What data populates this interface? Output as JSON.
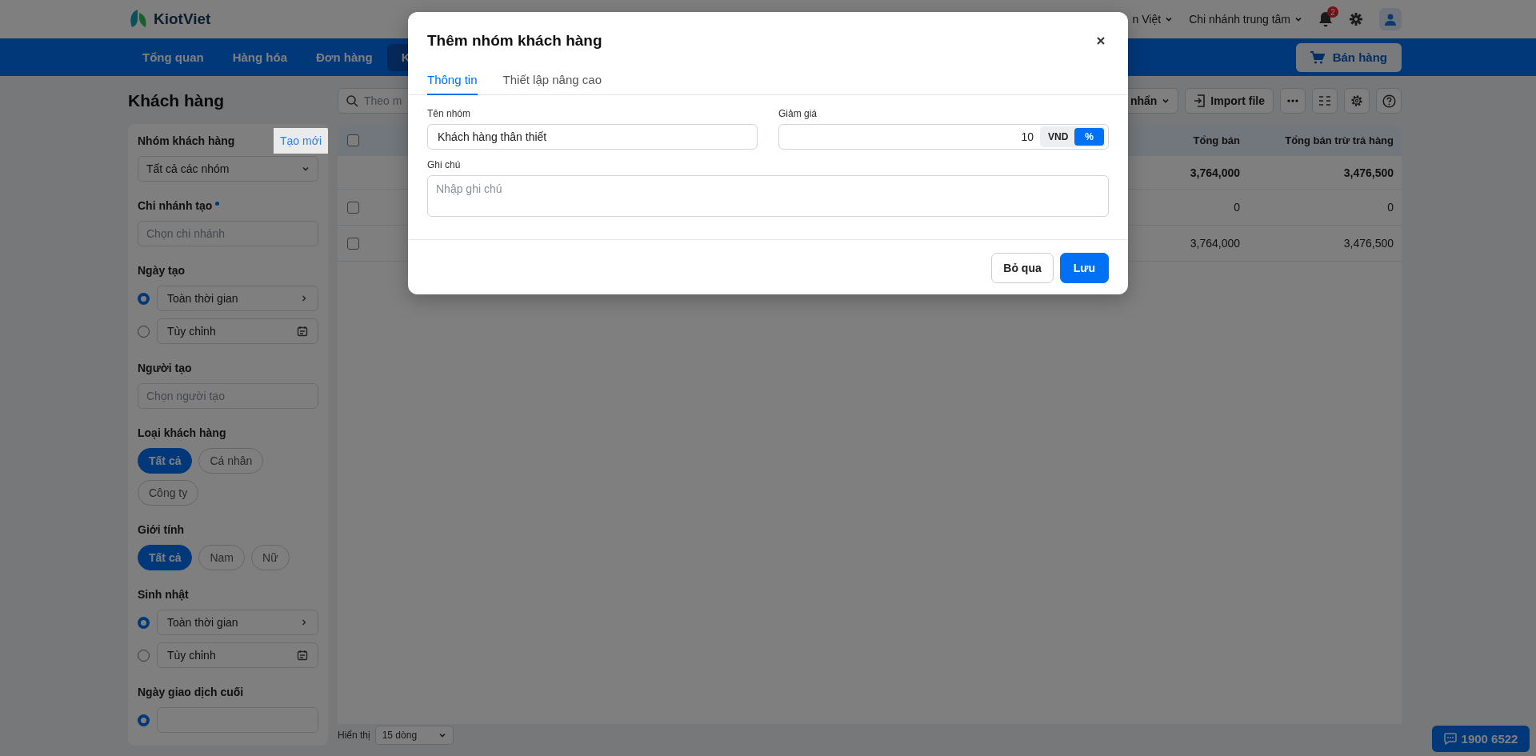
{
  "header": {
    "logo": "KiotViet",
    "language": "n Việt",
    "branch": "Chi nhánh trung tâm",
    "notification_count": "2"
  },
  "nav": {
    "items": [
      {
        "label": "Tổng quan",
        "selected": false
      },
      {
        "label": "Hàng hóa",
        "selected": false
      },
      {
        "label": "Đơn hàng",
        "selected": false
      },
      {
        "label": "K",
        "selected": true
      }
    ],
    "sell_button": "Bán hàng"
  },
  "title": "Khách hàng",
  "filters": [
    {
      "kind": "select",
      "label": "Nhóm khách hàng",
      "action": "Tạo mới",
      "value": "Tất cả các nhóm"
    },
    {
      "kind": "input",
      "label": "Chi nhánh tạo",
      "required": true,
      "placeholder": "Chọn chi nhánh"
    },
    {
      "kind": "radio",
      "label": "Ngày tạo",
      "options": [
        {
          "kind": "preset",
          "label": "Toàn thời gian",
          "selected": true
        },
        {
          "kind": "custom",
          "label": "Tùy chỉnh",
          "selected": false
        }
      ]
    },
    {
      "kind": "input",
      "label": "Người tạo",
      "placeholder": "Chọn người tạo"
    },
    {
      "kind": "chips",
      "label": "Loại khách hàng",
      "options": [
        {
          "label": "Tất cả",
          "selected": true
        },
        {
          "label": "Cá nhân",
          "selected": false
        },
        {
          "label": "Công ty",
          "selected": false
        }
      ]
    },
    {
      "kind": "chips",
      "label": "Giới tính",
      "options": [
        {
          "label": "Tất cả",
          "selected": true
        },
        {
          "label": "Nam",
          "selected": false
        },
        {
          "label": "Nữ",
          "selected": false
        }
      ]
    },
    {
      "kind": "radio",
      "label": "Sinh nhật",
      "options": [
        {
          "kind": "preset",
          "label": "Toàn thời gian",
          "selected": true
        },
        {
          "kind": "custom",
          "label": "Tùy chỉnh",
          "selected": false
        }
      ]
    },
    {
      "kind": "radio",
      "label": "Ngày giao dịch cuối",
      "options": [
        {
          "kind": "blank",
          "selected": true
        }
      ]
    }
  ],
  "toolbar": {
    "search_placeholder": "Theo m",
    "view_menu": "nhẩn",
    "import_button": "Import file"
  },
  "table": {
    "select_all": {
      "checked": false
    },
    "columns": [
      "Tổng bán",
      "Tổng bán trừ trả hàng"
    ],
    "summary": [
      "3,764,000",
      "3,476,500"
    ],
    "rows": [
      {
        "checked": false,
        "cells": [
          "0",
          "0"
        ]
      },
      {
        "checked": false,
        "cells": [
          "3,764,000",
          "3,476,500"
        ]
      }
    ]
  },
  "footer": {
    "label": "Hiển thị",
    "page_size": "15 dòng"
  },
  "hotline": "1900 6522",
  "dialog": {
    "title": "Thêm nhóm khách hàng",
    "tabs": [
      {
        "label": "Thông tin",
        "selected": true
      },
      {
        "label": "Thiết lập nâng cao",
        "selected": false
      }
    ],
    "name": {
      "label": "Tên nhóm",
      "value": "Khách hàng thân thiết"
    },
    "discount": {
      "label": "Giảm giá",
      "value": "10",
      "units": [
        {
          "label": "VND",
          "selected": false
        },
        {
          "label": "%",
          "selected": true
        }
      ]
    },
    "note": {
      "label": "Ghi chú",
      "placeholder": "Nhập ghi chú"
    },
    "buttons": [
      {
        "label": "Bỏ qua",
        "kind": "secondary"
      },
      {
        "label": "Lưu",
        "kind": "primary"
      }
    ]
  }
}
